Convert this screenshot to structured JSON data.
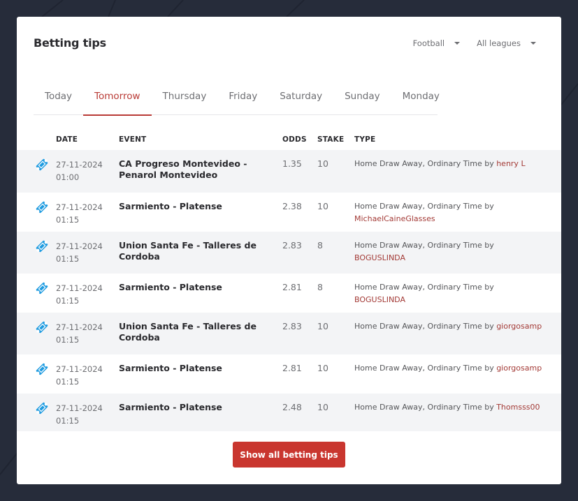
{
  "header": {
    "title": "Betting tips",
    "sport_filter": "Football",
    "league_filter": "All leagues"
  },
  "tabs": [
    {
      "label": "Today",
      "active": false
    },
    {
      "label": "Tomorrow",
      "active": true
    },
    {
      "label": "Thursday",
      "active": false
    },
    {
      "label": "Friday",
      "active": false
    },
    {
      "label": "Saturday",
      "active": false
    },
    {
      "label": "Sunday",
      "active": false
    },
    {
      "label": "Monday",
      "active": false
    }
  ],
  "table": {
    "columns": {
      "date": "DATE",
      "event": "EVENT",
      "odds": "ODDS",
      "stake": "STAKE",
      "type": "TYPE"
    },
    "rows": [
      {
        "date": "27-11-2024",
        "time": "01:00",
        "event": "CA Progreso Montevideo - Penarol Montevideo",
        "odds": "1.35",
        "stake": "10",
        "type": "Home Draw Away, Ordinary Time by",
        "tipster": "henry L"
      },
      {
        "date": "27-11-2024",
        "time": "01:15",
        "event": "Sarmiento - Platense",
        "odds": "2.38",
        "stake": "10",
        "type": "Home Draw Away, Ordinary Time by",
        "tipster": "MichaelCaineGlasses"
      },
      {
        "date": "27-11-2024",
        "time": "01:15",
        "event": "Union Santa Fe - Talleres de Cordoba",
        "odds": "2.83",
        "stake": "8",
        "type": "Home Draw Away, Ordinary Time by",
        "tipster": "BOGUSLINDA"
      },
      {
        "date": "27-11-2024",
        "time": "01:15",
        "event": "Sarmiento - Platense",
        "odds": "2.81",
        "stake": "8",
        "type": "Home Draw Away, Ordinary Time by",
        "tipster": "BOGUSLINDA"
      },
      {
        "date": "27-11-2024",
        "time": "01:15",
        "event": "Union Santa Fe - Talleres de Cordoba",
        "odds": "2.83",
        "stake": "10",
        "type": "Home Draw Away, Ordinary Time by",
        "tipster": "giorgosamp"
      },
      {
        "date": "27-11-2024",
        "time": "01:15",
        "event": "Sarmiento - Platense",
        "odds": "2.81",
        "stake": "10",
        "type": "Home Draw Away, Ordinary Time by",
        "tipster": "giorgosamp"
      },
      {
        "date": "27-11-2024",
        "time": "01:15",
        "event": "Sarmiento - Platense",
        "odds": "2.48",
        "stake": "10",
        "type": "Home Draw Away, Ordinary Time by",
        "tipster": "Thomsss00"
      }
    ]
  },
  "show_all_label": "Show all betting tips",
  "colors": {
    "accent": "#b93a35",
    "button": "#c9362f",
    "ticket_icon": "#1e9be0",
    "background": "#262c3a"
  }
}
